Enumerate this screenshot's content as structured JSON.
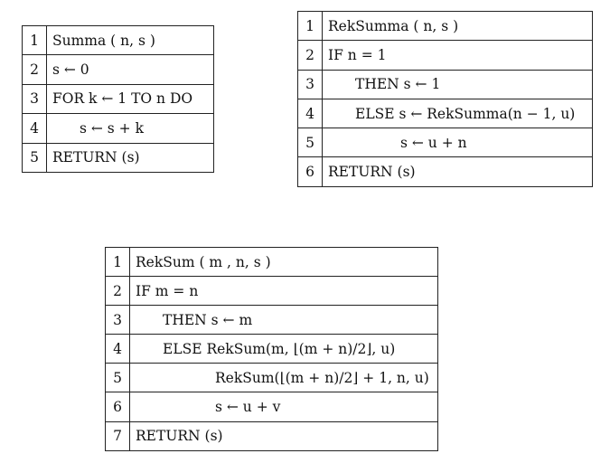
{
  "algorithms": [
    {
      "lines": [
        {
          "num": "1",
          "text": "Summa ( n, s )"
        },
        {
          "num": "2",
          "text": "s ← 0"
        },
        {
          "num": "3",
          "text": "FOR k ← 1 TO n DO"
        },
        {
          "num": "4",
          "text": "s ← s + k"
        },
        {
          "num": "5",
          "text": "RETURN (s)"
        }
      ]
    },
    {
      "lines": [
        {
          "num": "1",
          "text": "RekSumma ( n, s )"
        },
        {
          "num": "2",
          "text": "IF n = 1"
        },
        {
          "num": "3",
          "text": "THEN s ← 1"
        },
        {
          "num": "4",
          "text": "ELSE s ← RekSumma(n − 1, u)"
        },
        {
          "num": "5",
          "text": "s ← u + n"
        },
        {
          "num": "6",
          "text": "RETURN (s)"
        }
      ]
    },
    {
      "lines": [
        {
          "num": "1",
          "text": "RekSum ( m , n, s )"
        },
        {
          "num": "2",
          "text": "IF m = n"
        },
        {
          "num": "3",
          "text": "THEN s ← m"
        },
        {
          "num": "4",
          "text": "ELSE RekSum(m, ⌊(m + n)/2⌋, u)"
        },
        {
          "num": "5",
          "text": "RekSum(⌊(m + n)/2⌋ + 1, n, u)"
        },
        {
          "num": "6",
          "text": "s ← u + v"
        },
        {
          "num": "7",
          "text": "RETURN (s)"
        }
      ]
    }
  ]
}
